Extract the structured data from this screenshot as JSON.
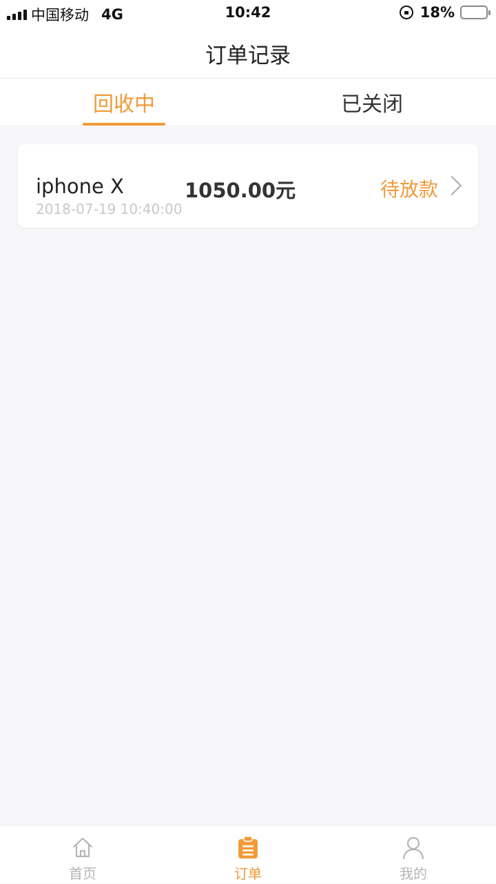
{
  "status_bar": {
    "carrier": "中国移动",
    "network": "4G",
    "time": "10:42",
    "battery_percent": "18%",
    "battery_level": 0.18
  },
  "header": {
    "title": "订单记录"
  },
  "tabs": [
    {
      "label": "回收中",
      "active": true
    },
    {
      "label": "已关闭",
      "active": false
    }
  ],
  "orders": [
    {
      "product": "iphone X",
      "price": "1050.00元",
      "time": "2018-07-19 10:40:00",
      "status": "待放款"
    }
  ],
  "tab_bar": {
    "items": [
      {
        "label": "首页",
        "icon": "home-icon",
        "active": false
      },
      {
        "label": "订单",
        "icon": "order-clipboard-icon",
        "active": true
      },
      {
        "label": "我的",
        "icon": "user-icon",
        "active": false
      }
    ]
  },
  "colors": {
    "accent": "#f29a38",
    "inactive": "#b5b5b5",
    "background": "#f7f7f9"
  }
}
